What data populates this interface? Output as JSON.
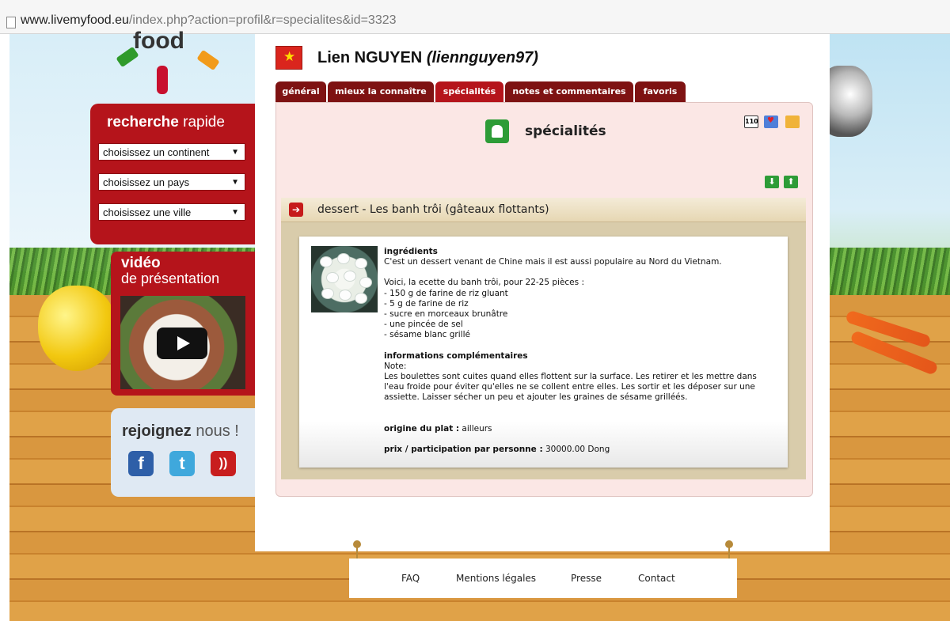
{
  "browser": {
    "url_host": "www.livemyfood.eu",
    "url_path": "/index.php?action=profil&r=specialites&id=3323"
  },
  "logo": {
    "text": "food"
  },
  "search": {
    "title_bold": "recherche",
    "title_rest": " rapide",
    "continent": "choisissez un continent",
    "country": "choisissez un pays",
    "city": "choisissez une ville"
  },
  "video": {
    "line1": "vidéo",
    "line2": "de présentation"
  },
  "join": {
    "title_bold": "rejoignez",
    "title_rest": " nous !"
  },
  "profile": {
    "name": "Lien NGUYEN",
    "username": "(liennguyen97)",
    "flag": "vietnam"
  },
  "tabs": [
    {
      "label": "général"
    },
    {
      "label": "mieux la connaître"
    },
    {
      "label": "spécialités"
    },
    {
      "label": "notes et commentaires"
    },
    {
      "label": "favoris"
    }
  ],
  "active_tab": "spécialités",
  "section": {
    "title": "spécialités",
    "count_badge": "110"
  },
  "dish": {
    "title": "dessert - Les banh trôi (gâteaux flottants)",
    "ingredients_heading": "ingrédients",
    "intro": "C'est un dessert venant de Chine mais il est aussi populaire au Nord du Vietnam.",
    "recipe_line": "Voici, la ecette du banh trôi, pour 22-25 pièces :",
    "ingredients": [
      "- 150 g de farine de riz gluant",
      "- 5 g de farine de riz",
      "- sucre en morceaux brunâtre",
      "- une pincée de sel",
      "- sésame blanc grillé"
    ],
    "info_heading": "informations complémentaires",
    "note_label": "Note:",
    "note_text": "Les boulettes sont cuites quand elles flottent sur la surface. Les retirer et les mettre dans l'eau froide pour éviter qu'elles ne se collent entre elles. Les sortir et les déposer sur une assiette. Laisser sécher un peu et ajouter les graines de sésame grilléés.",
    "origin_label": "origine du plat :",
    "origin_value": " ailleurs",
    "price_label": "prix / participation par personne :",
    "price_value": " 30000.00 Dong"
  },
  "footer": {
    "faq": "FAQ",
    "legal": "Mentions légales",
    "press": "Presse",
    "contact": "Contact"
  },
  "colors": {
    "brand_red": "#b5141b",
    "tab_dark": "#7e1212",
    "panel_pink": "#fbe7e5",
    "green": "#2d9c37"
  }
}
